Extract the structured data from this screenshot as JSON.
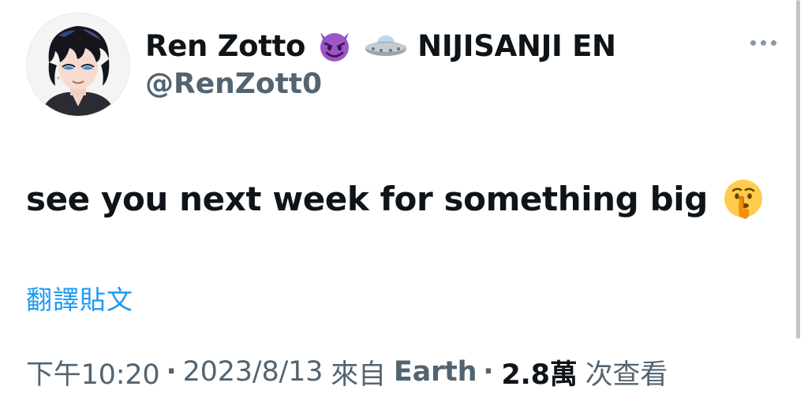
{
  "tweet": {
    "author": {
      "display_name": "Ren Zotto",
      "affiliation": "NIJISANJI EN",
      "handle": "@RenZott0",
      "name_emojis": [
        "smiling-imp-emoji",
        "ufo-emoji"
      ]
    },
    "text": "see you next week for something big",
    "text_emoji": "shushing-face-emoji",
    "translate_label": "翻譯貼文",
    "meta": {
      "time": "下午10:20",
      "date": "2023/8/13",
      "source_prefix": "來自",
      "source_name": "Earth",
      "views_count": "2.8萬",
      "views_label": "次查看",
      "separator": "·"
    },
    "more_icon": "more-horizontal-icon"
  },
  "colors": {
    "text_primary": "#0f1419",
    "text_secondary": "#536471",
    "link": "#1d9bf0",
    "background": "#ffffff"
  }
}
